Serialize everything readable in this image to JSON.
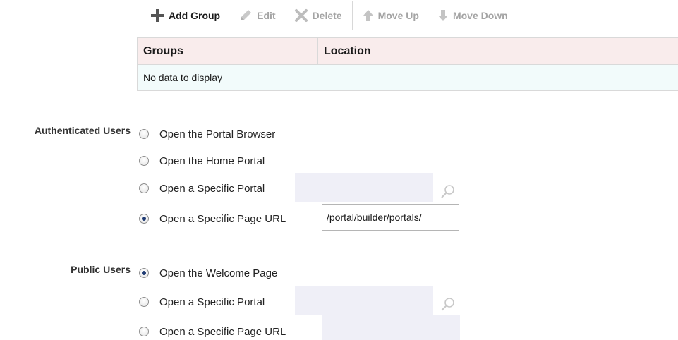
{
  "toolbar": {
    "add_group": "Add Group",
    "edit": "Edit",
    "delete": "Delete",
    "move_up": "Move Up",
    "move_down": "Move Down"
  },
  "groups_table": {
    "columns": [
      "Groups",
      "Location"
    ],
    "rows": [],
    "empty_message": "No data to display"
  },
  "authenticated_users": {
    "label": "Authenticated Users",
    "options": [
      {
        "label": "Open the Portal Browser",
        "checked": false
      },
      {
        "label": "Open the Home Portal",
        "checked": false
      },
      {
        "label": "Open a Specific Portal",
        "checked": false,
        "value": ""
      },
      {
        "label": "Open a Specific Page URL",
        "checked": true,
        "value": "/portal/builder/portals/"
      }
    ]
  },
  "public_users": {
    "label": "Public Users",
    "options": [
      {
        "label": "Open the Welcome Page",
        "checked": true
      },
      {
        "label": "Open a Specific Portal",
        "checked": false,
        "value": ""
      },
      {
        "label": "Open a Specific Page URL",
        "checked": false,
        "value": ""
      }
    ]
  },
  "icons": {
    "add": "plus-icon",
    "edit": "pencil-icon",
    "delete": "x-icon",
    "move_up": "arrow-up-icon",
    "move_down": "arrow-down-icon",
    "search": "search-icon"
  },
  "colors": {
    "table_header_bg": "#f9ecec",
    "table_body_bg": "#f2fbfb",
    "input_bg": "#efeff7",
    "radio_dot": "#1f3b73"
  }
}
